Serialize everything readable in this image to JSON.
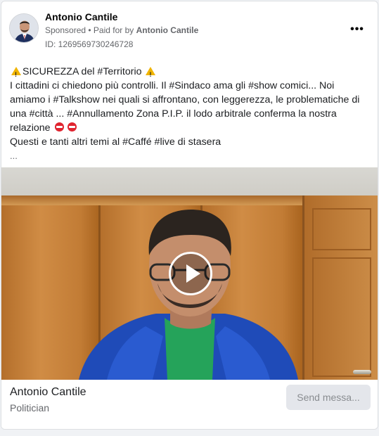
{
  "post": {
    "page_name": "Antonio Cantile",
    "sponsored_label": "Sponsored",
    "paid_for_prefix": " • Paid for by ",
    "paid_for_name": "Antonio Cantile",
    "ad_id": "ID: 1269569730246728",
    "more_label": "•••"
  },
  "body": {
    "line1_text": "SICUREZZA del #Territorio",
    "line2": "I cittadini ci chiedono più controlli. Il #Sindaco ama gli #show comici... Noi",
    "line3": "amiamo i #Talkshow nei quali si affrontano, con leggerezza, le problematiche di",
    "line4": "una #città ... #Annullamento Zona P.I.P. il lodo arbitrale conferma la nostra",
    "line5": "relazione",
    "line6": "Questi e tanti altri temi al #Caffé #live di stasera",
    "ellipsis": "...",
    "icons": [
      "warning-icon",
      "no-entry-icon"
    ]
  },
  "video": {
    "play_icon": "play-icon"
  },
  "footer": {
    "page_name": "Antonio Cantile",
    "category": "Politician",
    "cta_label": "Send messa..."
  },
  "colors": {
    "secondary_text": "#65676b",
    "cta_bg": "#e4e6eb",
    "cta_text": "#8a8d91",
    "jacket": "#1f4bb8",
    "shirt": "#25a35a"
  }
}
